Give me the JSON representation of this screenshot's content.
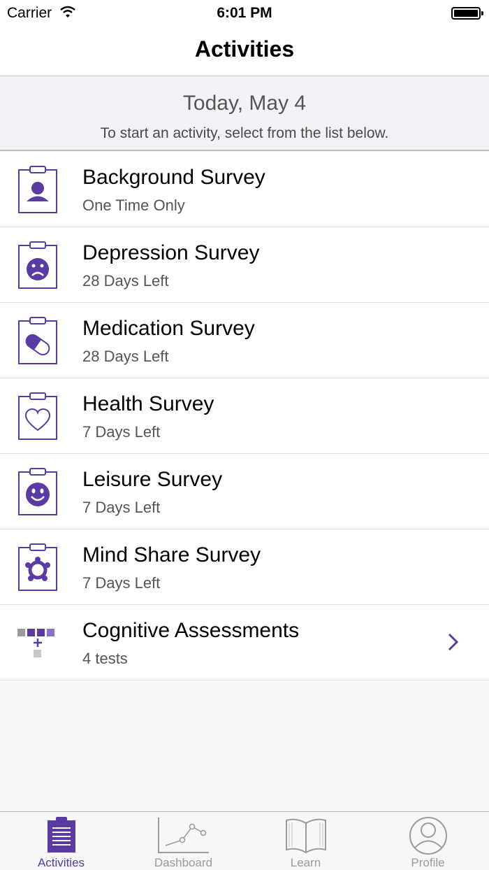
{
  "status_bar": {
    "carrier": "Carrier",
    "time": "6:01 PM"
  },
  "nav": {
    "title": "Activities"
  },
  "header": {
    "date": "Today, May 4",
    "instructions": "To start an activity, select from the list below."
  },
  "activities": [
    {
      "title": "Background Survey",
      "subtitle": "One Time Only",
      "icon": "person-clipboard-icon"
    },
    {
      "title": "Depression Survey",
      "subtitle": "28 Days Left",
      "icon": "sad-face-clipboard-icon"
    },
    {
      "title": "Medication Survey",
      "subtitle": "28 Days Left",
      "icon": "pill-clipboard-icon"
    },
    {
      "title": "Health Survey",
      "subtitle": "7 Days Left",
      "icon": "heart-clipboard-icon"
    },
    {
      "title": "Leisure Survey",
      "subtitle": "7 Days Left",
      "icon": "smile-face-clipboard-icon"
    },
    {
      "title": "Mind Share Survey",
      "subtitle": "7 Days Left",
      "icon": "network-clipboard-icon"
    },
    {
      "title": "Cognitive Assessments",
      "subtitle": "4 tests",
      "icon": "blocks-plus-icon"
    }
  ],
  "tabs": [
    {
      "label": "Activities",
      "icon": "clipboard-list-icon",
      "active": true
    },
    {
      "label": "Dashboard",
      "icon": "line-chart-icon",
      "active": false
    },
    {
      "label": "Learn",
      "icon": "open-book-icon",
      "active": false
    },
    {
      "label": "Profile",
      "icon": "user-circle-icon",
      "active": false
    }
  ],
  "colors": {
    "accent": "#5a3aa3",
    "inactive": "#9a9a9f",
    "header_bg": "#f3f2f6"
  }
}
